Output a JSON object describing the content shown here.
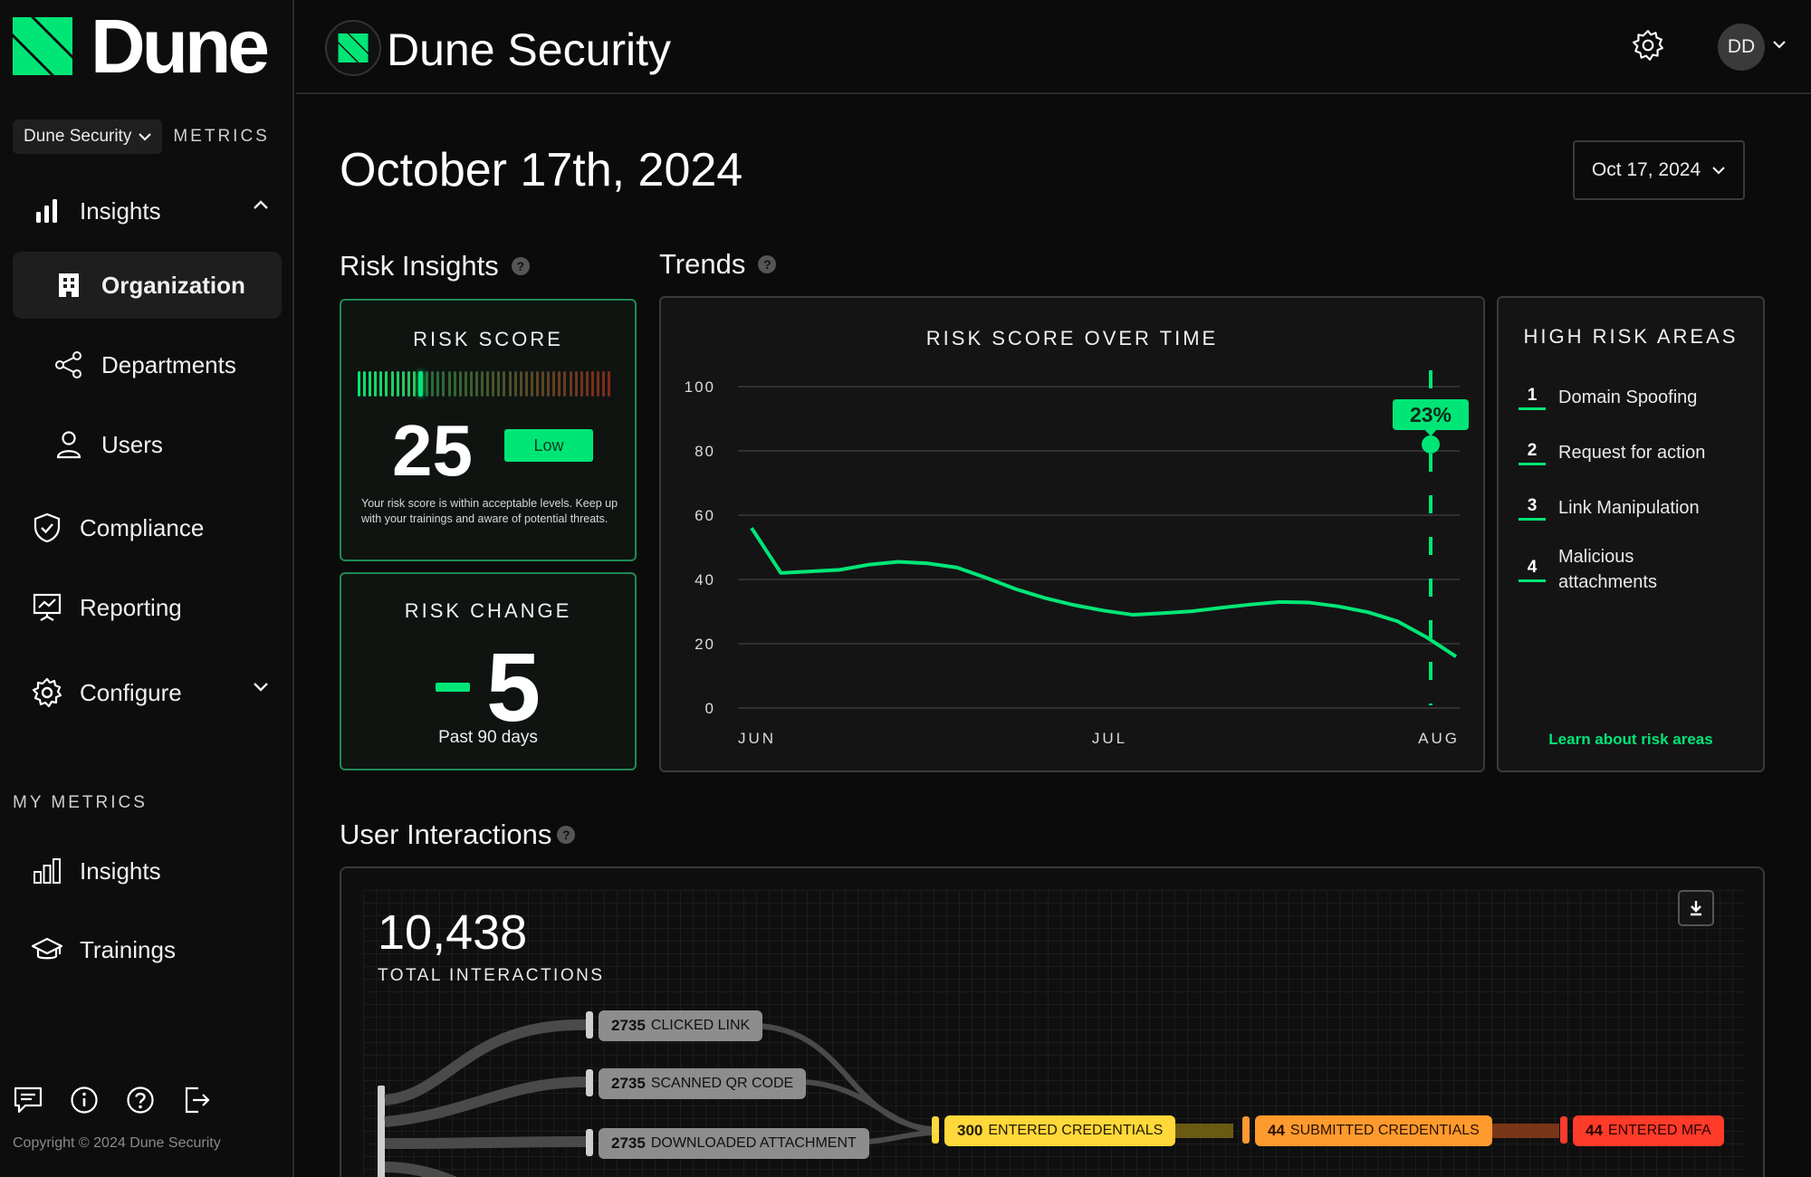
{
  "sidebar": {
    "logo_text": "Dune",
    "org_select": "Dune Security",
    "metrics_label": "METRICS",
    "nav": [
      {
        "label": "Insights"
      },
      {
        "label": "Organization"
      },
      {
        "label": "Departments"
      },
      {
        "label": "Users"
      },
      {
        "label": "Compliance"
      },
      {
        "label": "Reporting"
      },
      {
        "label": "Configure"
      }
    ],
    "my_metrics_label": "MY METRICS",
    "my_metrics": [
      {
        "label": "Insights"
      },
      {
        "label": "Trainings"
      }
    ],
    "copyright": "Copyright © 2024 Dune Security"
  },
  "header": {
    "title": "Dune Security",
    "avatar_initials": "DD"
  },
  "main": {
    "page_title": "October 17th, 2024",
    "date_select": "Oct 17, 2024",
    "risk_insights_heading": "Risk Insights",
    "trends_heading": "Trends",
    "risk_score": {
      "title": "RISK SCORE",
      "value": "25",
      "level": "Low",
      "description": "Your risk score is within acceptable levels. Keep up with your trainings and aware of potential threats."
    },
    "risk_change": {
      "title": "RISK CHANGE",
      "value": "5",
      "period": "Past 90 days"
    },
    "high_risk": {
      "title": "HIGH RISK AREAS",
      "items": [
        {
          "n": "1",
          "label": "Domain Spoofing"
        },
        {
          "n": "2",
          "label": "Request for action"
        },
        {
          "n": "3",
          "label": "Link Manipulation"
        },
        {
          "n": "4",
          "label": "Malicious attachments"
        }
      ],
      "link": "Learn about risk areas"
    },
    "user_interactions": {
      "heading": "User Interactions",
      "total": "10,438",
      "total_label": "TOTAL INTERACTIONS",
      "flows": [
        {
          "count": "2735",
          "label": "CLICKED LINK"
        },
        {
          "count": "2735",
          "label": "SCANNED QR CODE"
        },
        {
          "count": "2735",
          "label": "DOWNLOADED ATTACHMENT"
        },
        {
          "count": "300",
          "label": "ENTERED CREDENTIALS"
        },
        {
          "count": "44",
          "label": "SUBMITTED CREDENTIALS"
        },
        {
          "count": "44",
          "label": "ENTERED MFA"
        }
      ]
    }
  },
  "chart_data": {
    "type": "line",
    "title": "RISK SCORE OVER TIME",
    "xlabel": "",
    "ylabel": "",
    "ylim": [
      0,
      100
    ],
    "yticks": [
      0,
      20,
      40,
      60,
      80,
      100
    ],
    "xticks": [
      "JUN",
      "JUL",
      "AUG"
    ],
    "series": [
      {
        "values": [
          56,
          42,
          42.5,
          43,
          44.6,
          45.5,
          45,
          43.7,
          40.5,
          37,
          34.2,
          32,
          30.3,
          29,
          29.5,
          30.1,
          31.2,
          32.2,
          33,
          32.8,
          31.6,
          29.8,
          27,
          22,
          16
        ]
      }
    ],
    "marker": {
      "label": "23%",
      "value": 82
    },
    "grid": true,
    "colors": {
      "line": "#00e676"
    }
  }
}
